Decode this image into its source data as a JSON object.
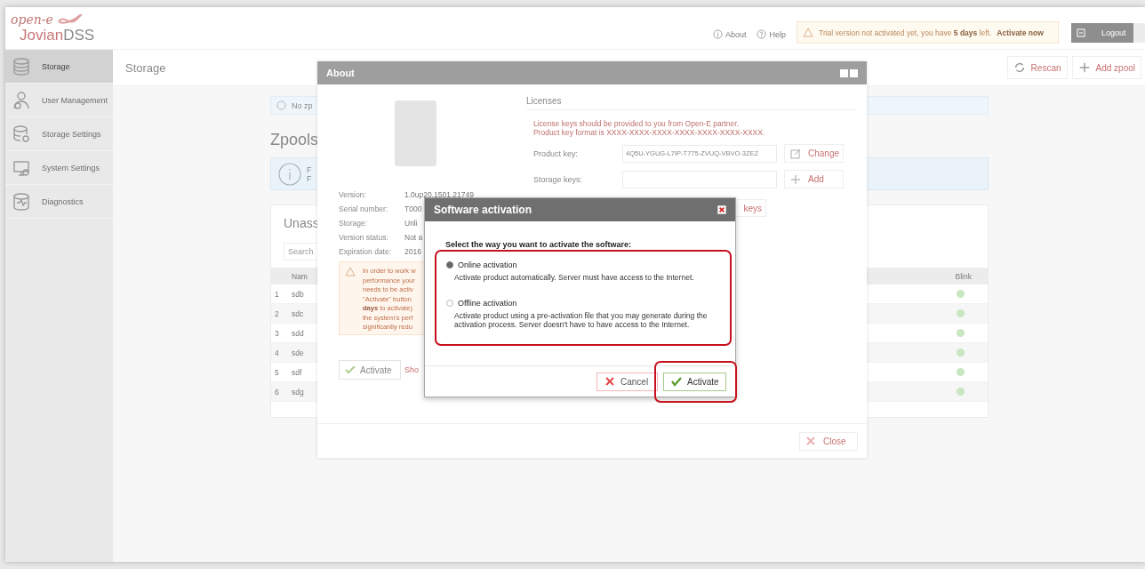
{
  "header": {
    "logo_tagline": "open-e",
    "logo_brand": "Jovian",
    "logo_suffix": "DSS",
    "links": [
      {
        "label": "About"
      },
      {
        "label": "Help"
      }
    ],
    "trial_banner": {
      "text": "Trial version not activated yet, you have **5 days** left.",
      "link": "Activate now"
    },
    "logout": "Logout"
  },
  "sidebar": {
    "items": [
      {
        "label": "Storage",
        "selected": true
      },
      {
        "label": "User Management",
        "selected": false
      },
      {
        "label": "Storage Settings",
        "selected": false
      },
      {
        "label": "System Settings",
        "selected": false
      },
      {
        "label": "Diagnostics",
        "selected": false
      }
    ]
  },
  "page": {
    "title": "Storage",
    "actions": [
      "Rescan",
      "Add zpool"
    ],
    "notice": "No zp",
    "section_title": "Zpools",
    "info_lines": [
      "F",
      "F"
    ],
    "unassigned": {
      "title": "Unass",
      "search_placeholder": "Search",
      "columns": [
        "Nam",
        "Blink"
      ],
      "rows": [
        {
          "index": "1",
          "name": "sdb"
        },
        {
          "index": "2",
          "name": "sdc"
        },
        {
          "index": "3",
          "name": "sdd"
        },
        {
          "index": "4",
          "name": "sde"
        },
        {
          "index": "5",
          "name": "sdf"
        },
        {
          "index": "6",
          "name": "sdg"
        }
      ]
    }
  },
  "about_dialog": {
    "title": "About",
    "details": [
      {
        "label": "Version:",
        "value": "1.0up20.1501.21749"
      },
      {
        "label": "Serial number:",
        "value": "T000"
      },
      {
        "label": "Storage:",
        "value": "Unli"
      },
      {
        "label": "Version status:",
        "value": "Not a"
      },
      {
        "label": "Expiration date:",
        "value": "2016"
      }
    ],
    "warning_lines": [
      "In order to work w",
      "performance your",
      "needs to be activ",
      "\"Activate\" button",
      "**days** to activate)",
      "the system's perf",
      "significantly redu"
    ],
    "activate_button": "Activate",
    "show_link": "Sho",
    "licenses": {
      "title": "Licenses",
      "note_lines": [
        "License keys should be provided to you from Open-E partner.",
        "Product key format is XXXX-XXXX-XXXX-XXXX-XXXX-XXXX-XXXX."
      ],
      "product_key_label": "Product key:",
      "product_key": "4Q5U-YGUG-L7IP-T775-ZVUQ-VBVO-3ZEZ",
      "change_button": "Change",
      "storage_keys_label": "Storage keys:",
      "add_button": "Add",
      "keys_button": "keys"
    },
    "close_button": "Close"
  },
  "activation_dialog": {
    "title": "Software activation",
    "prompt": "Select the way you want to activate the software:",
    "options": [
      {
        "label": "Online activation",
        "description": "Activate product automatically. Server must have access to the Internet.",
        "selected": true
      },
      {
        "label": "Offline activation",
        "description": "Activate product using a pre-activation file that you may generate during the activation process. Server doesn't have to have access to the Internet.",
        "selected": false
      }
    ],
    "cancel_button": "Cancel",
    "activate_button": "Activate"
  }
}
